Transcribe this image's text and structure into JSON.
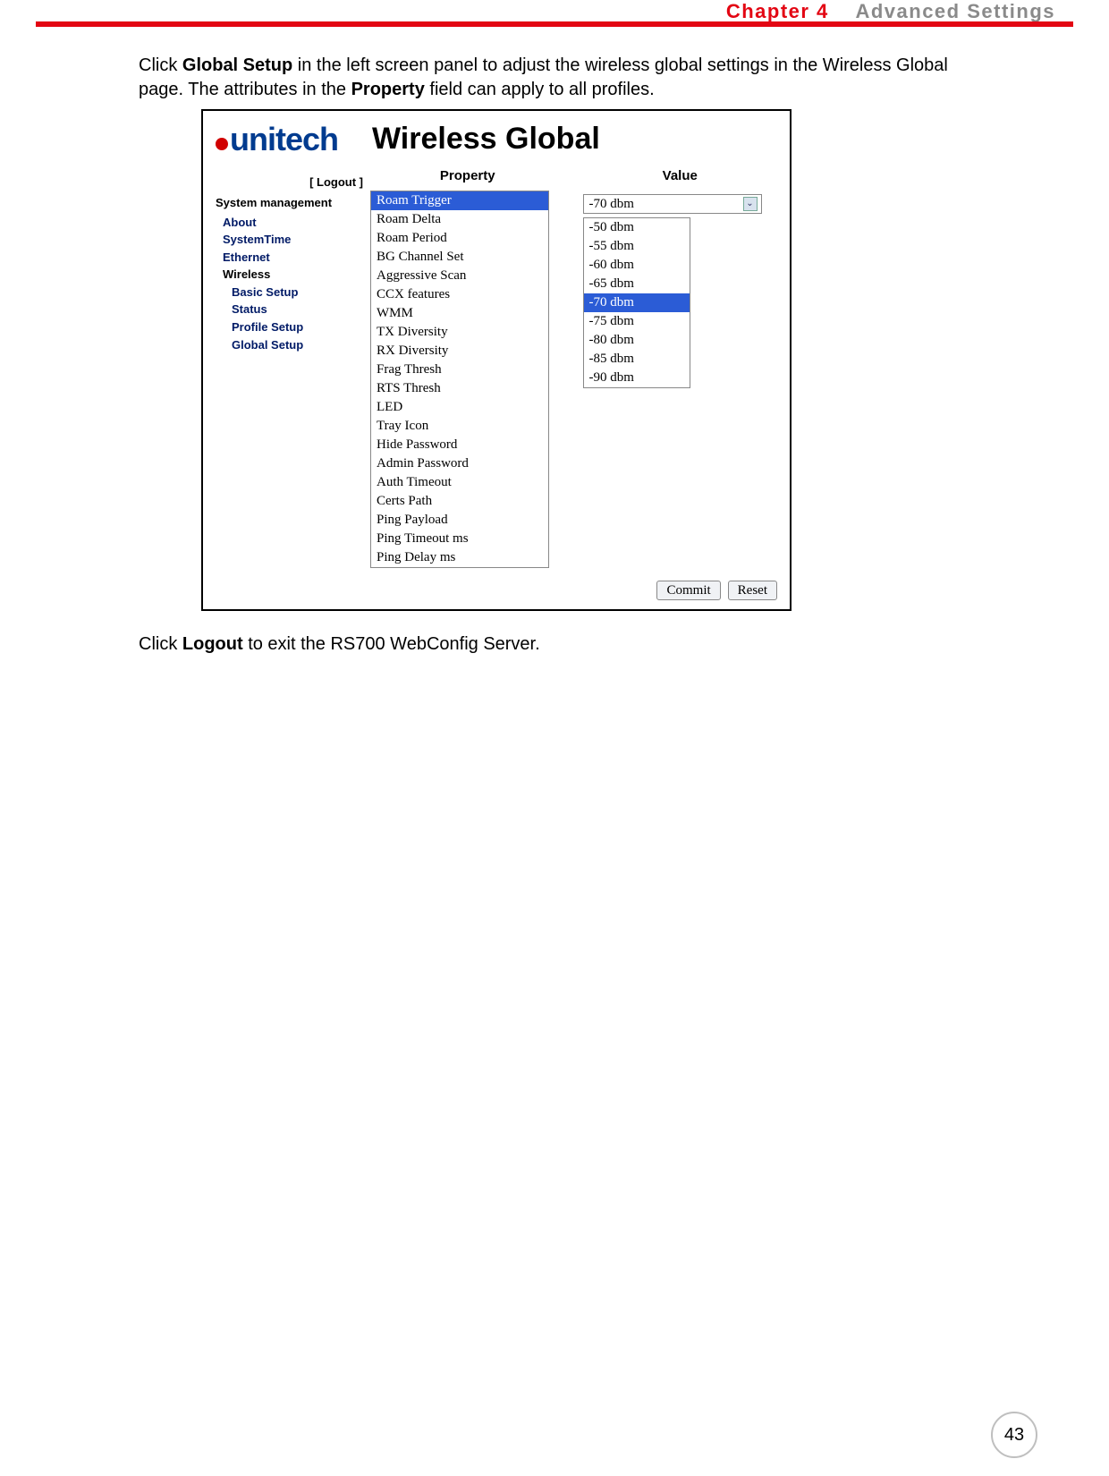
{
  "header": {
    "chapter_num": "Chapter 4",
    "chapter_title": "Advanced Settings"
  },
  "body": {
    "para1_pre": "Click ",
    "para1_bold": "Global Setup",
    "para1_mid": " in the left screen panel to adjust the wireless global settings in the Wireless Global page. The attributes in the ",
    "para1_bold2": "Property",
    "para1_post": " field can apply to all profiles.",
    "para2_pre": "Click ",
    "para2_bold": "Logout",
    "para2_post": " to exit the RS700 WebConfig Server."
  },
  "figure": {
    "logo_text": "unitech",
    "title": "Wireless Global",
    "logout": "[ Logout ]",
    "sys_mgmt": "System management",
    "sidebar": {
      "about": "About",
      "system_time": "SystemTime",
      "ethernet": "Ethernet",
      "wireless": "Wireless",
      "basic_setup": "Basic Setup",
      "status": "Status",
      "profile_setup": "Profile Setup",
      "global_setup": "Global Setup"
    },
    "columns": {
      "property": "Property",
      "value": "Value"
    },
    "properties": [
      "Roam Trigger",
      "Roam Delta",
      "Roam Period",
      "BG Channel Set",
      "Aggressive Scan",
      "CCX features",
      "WMM",
      "TX Diversity",
      "RX Diversity",
      "Frag Thresh",
      "RTS Thresh",
      "LED",
      "Tray Icon",
      "Hide Password",
      "Admin Password",
      "Auth Timeout",
      "Certs Path",
      "Ping Payload",
      "Ping Timeout ms",
      "Ping Delay ms"
    ],
    "selected_property_index": 0,
    "value_selected": "-70 dbm",
    "value_options": [
      "-50 dbm",
      "-55 dbm",
      "-60 dbm",
      "-65 dbm",
      "-70 dbm",
      "-75 dbm",
      "-80 dbm",
      "-85 dbm",
      "-90 dbm"
    ],
    "value_selected_index": 4,
    "buttons": {
      "commit": "Commit",
      "reset": "Reset"
    }
  },
  "page_number": "43"
}
